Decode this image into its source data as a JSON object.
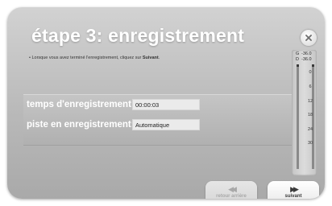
{
  "dialog": {
    "title": "étape 3: enregistrement",
    "instruction": {
      "bullet": "•",
      "text": "Lorsque vous avez terminé l'enregistrement, cliquez sur",
      "link_word": "Suivant",
      "end": "."
    }
  },
  "fields": {
    "time_label": "temps d'enregistrement:",
    "time_value": "00:00:03",
    "track_label": "piste en enregistrement:",
    "track_value": "Automatique"
  },
  "meter": {
    "g_label": "G",
    "g_value": "-36.0",
    "d_label": "D",
    "d_value": "-36.0",
    "ticks": [
      "0",
      "6",
      "12",
      "18",
      "24",
      "30"
    ]
  },
  "buttons": {
    "back_label": "retour arrière",
    "back_icon": "rewind-icon",
    "next_label": "suivant",
    "next_icon": "fast-forward-icon"
  },
  "colors": {
    "panel": "#b9b9b9",
    "title": "#ffffff",
    "text_dark": "#333333",
    "disabled_text": "#a8a8a8"
  }
}
